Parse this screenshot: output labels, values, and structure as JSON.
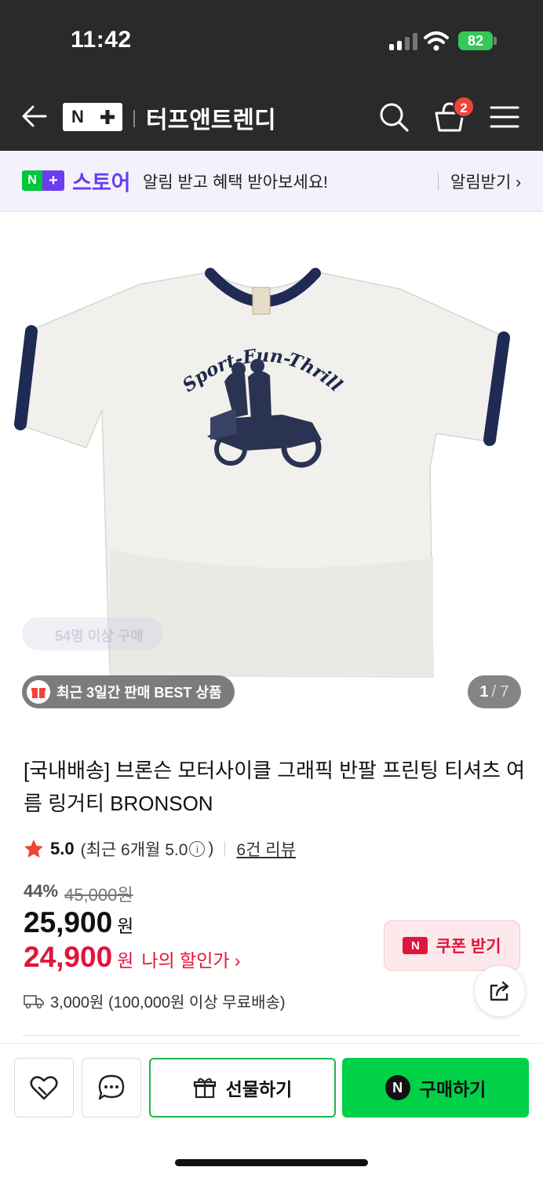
{
  "status_bar": {
    "time": "11:42",
    "battery": "82"
  },
  "header": {
    "store_name": "터프앤트렌디",
    "logo_n": "N",
    "cart_count": "2"
  },
  "notify_banner": {
    "store_label": "스토어",
    "message": "알림 받고 혜택 받아보세요!",
    "link": "알림받기 ›"
  },
  "image": {
    "faded_chip": "54명 이상 구매",
    "badge": "최근 3일간 판매 BEST 상품",
    "page_current": "1",
    "page_total": "/ 7",
    "print_text": "Sport-Fun-Thrills!"
  },
  "product": {
    "title": "[국내배송] 브론슨 모터사이클 그래픽 반팔 프린팅 티셔츠 여름 링거티 BRONSON",
    "rating": "5.0",
    "rating_sub": "(최근 6개월 5.0",
    "rating_close": ")",
    "reviews": "6건 리뷰",
    "discount_rate": "44%",
    "original_price": "45,000원",
    "price": "25,900",
    "price_unit": "원",
    "my_price": "24,900",
    "my_price_unit": "원",
    "my_price_label": "나의 할인가 ›",
    "shipping": "3,000원 (100,000원 이상 무료배송)",
    "coupon": "쿠폰 받기"
  },
  "actions": {
    "gift": "선물하기",
    "buy": "구매하기",
    "n_mark": "N"
  },
  "colors": {
    "accent_green": "#00d148",
    "price_red": "#e0153b",
    "store_purple": "#6b3cf0"
  }
}
